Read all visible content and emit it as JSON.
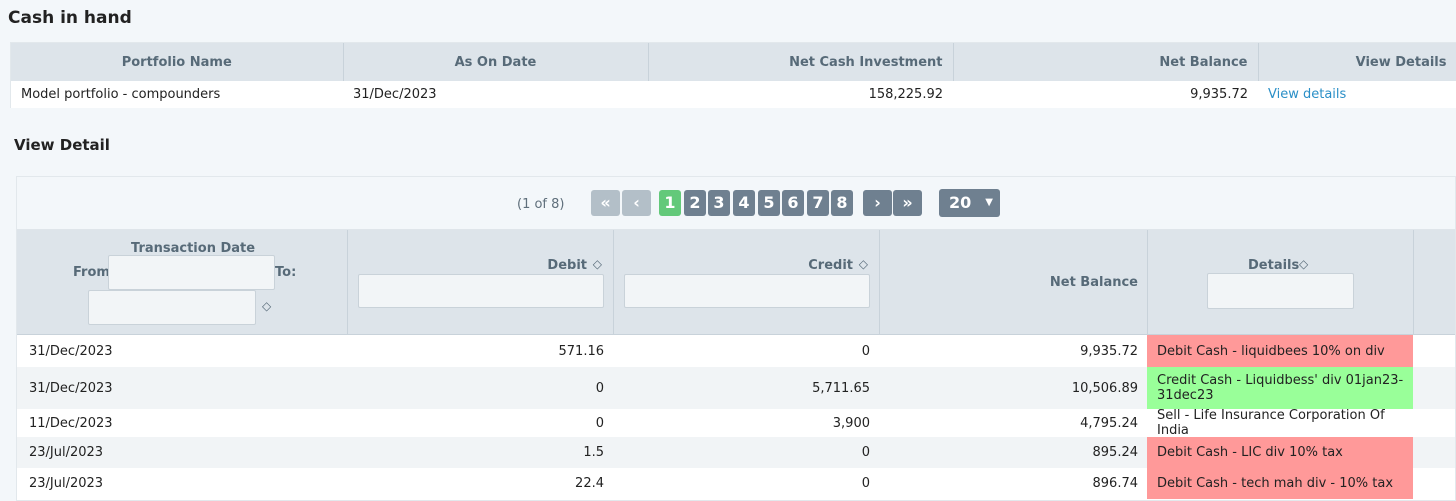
{
  "summary": {
    "title": "Cash in hand",
    "headers": [
      "Portfolio Name",
      "As On Date",
      "Net Cash Investment",
      "Net Balance",
      "View Details"
    ],
    "row": {
      "portfolio_name": "Model portfolio - compounders",
      "as_on_date": "31/Dec/2023",
      "net_cash_investment": "158,225.92",
      "net_balance": "9,935.72",
      "view_details": "View details"
    }
  },
  "detail": {
    "title": "View Detail",
    "paginator": {
      "info": "(1 of 8)",
      "first_icon": "double-chevron-left",
      "prev_icon": "chevron-left",
      "next_icon": "chevron-right",
      "last_icon": "double-chevron-right",
      "pages": [
        "1",
        "2",
        "3",
        "4",
        "5",
        "6",
        "7",
        "8"
      ],
      "current_page": "1",
      "rows_per_page": "20"
    },
    "columns": {
      "transaction_date": "Transaction Date",
      "from_label": "From:",
      "to_label": "To:",
      "debit": "Debit",
      "credit": "Credit",
      "net_balance": "Net Balance",
      "details": "Details"
    },
    "colors": {
      "debit_row": "#ff9999",
      "credit_row": "#99ff99"
    },
    "rows": [
      {
        "date": "31/Dec/2023",
        "debit": "571.16",
        "credit": "0",
        "net_balance": "9,935.72",
        "details": "Debit Cash - liquidbees 10% on div",
        "type": "red"
      },
      {
        "date": "31/Dec/2023",
        "debit": "0",
        "credit": "5,711.65",
        "net_balance": "10,506.89",
        "details": "Credit Cash - Liquidbess' div 01jan23-31dec23",
        "type": "green"
      },
      {
        "date": "11/Dec/2023",
        "debit": "0",
        "credit": "3,900",
        "net_balance": "4,795.24",
        "details": "Sell - Life Insurance Corporation Of India",
        "type": "none"
      },
      {
        "date": "23/Jul/2023",
        "debit": "1.5",
        "credit": "0",
        "net_balance": "895.24",
        "details": "Debit Cash - LIC div 10% tax",
        "type": "red"
      },
      {
        "date": "23/Jul/2023",
        "debit": "22.4",
        "credit": "0",
        "net_balance": "896.74",
        "details": "Debit Cash - tech mah div - 10% tax",
        "type": "red"
      }
    ]
  }
}
